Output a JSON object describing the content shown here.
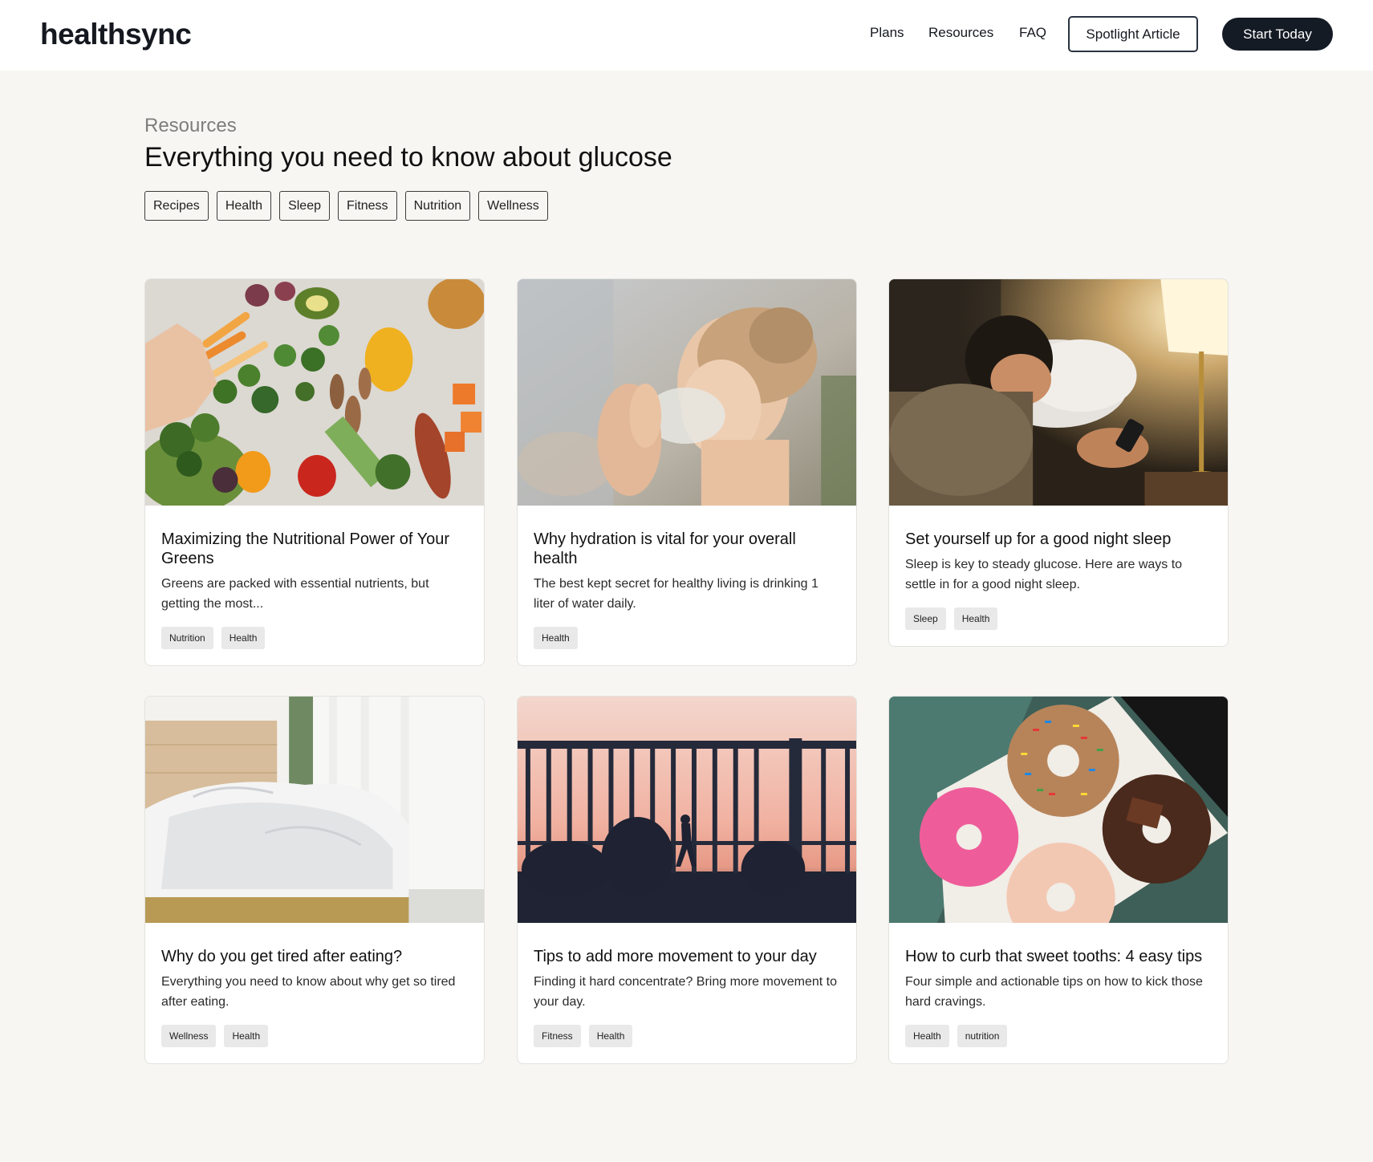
{
  "header": {
    "logo": "healthsync",
    "nav": [
      "Plans",
      "Resources",
      "FAQ"
    ],
    "spotlight_button": "Spotlight Article",
    "cta_button": "Start Today"
  },
  "hero": {
    "eyebrow": "Resources",
    "title": "Everything you need to know about glucose",
    "filters": [
      "Recipes",
      "Health",
      "Sleep",
      "Fitness",
      "Nutrition",
      "Wellness"
    ]
  },
  "cards": [
    {
      "title": "Maximizing the Nutritional Power of Your Greens",
      "description": "Greens are packed with essential nutrients, but getting the most...",
      "tags": [
        "Nutrition",
        "Health"
      ],
      "image": "vegetables-photo"
    },
    {
      "title": "Why hydration is vital for your overall health",
      "description": "The best kept secret for healthy living is drinking 1 liter of water daily.",
      "tags": [
        "Health"
      ],
      "image": "woman-drinking-water-photo"
    },
    {
      "title": "Set yourself up for a good night sleep",
      "description": "Sleep is key to steady glucose. Here are ways to settle in for a good night sleep.",
      "tags": [
        "Sleep",
        "Health"
      ],
      "image": "woman-in-bed-phone-photo"
    },
    {
      "title": "Why do you get tired after eating?",
      "description": "Everything you need to know about why get so tired after eating.",
      "tags": [
        "Wellness",
        "Health"
      ],
      "image": "unmade-bed-photo"
    },
    {
      "title": "Tips to add more movement to your day",
      "description": "Finding it hard concentrate? Bring more movement to your day.",
      "tags": [
        "Fitness",
        "Health"
      ],
      "image": "walking-silhouette-sunset-photo"
    },
    {
      "title": "How to curb that sweet tooths: 4 easy tips",
      "description": "Four simple and actionable tips on how to kick those hard cravings.",
      "tags": [
        "Health",
        "nutrition"
      ],
      "image": "donuts-box-photo"
    }
  ]
}
